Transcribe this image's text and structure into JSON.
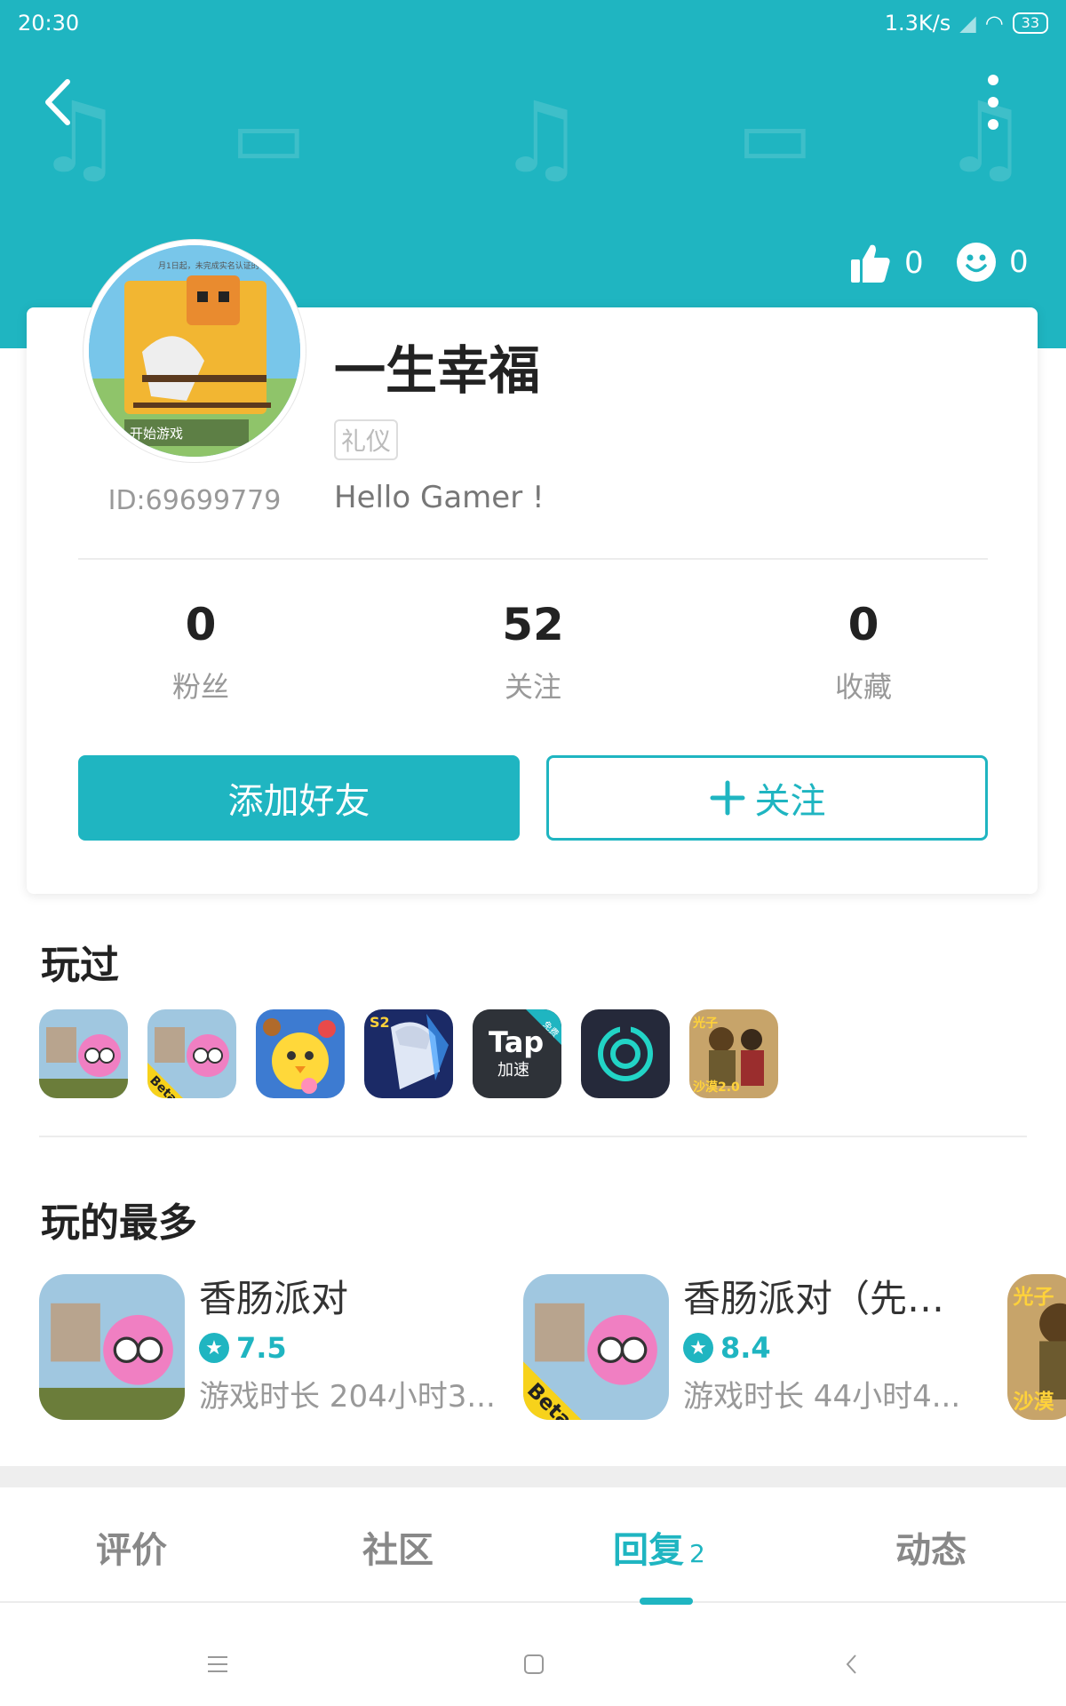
{
  "status_bar": {
    "time": "20:30",
    "network_speed": "1.3K/s",
    "battery": "33"
  },
  "header": {
    "back_icon": "chevron-left-icon",
    "more_icon": "more-vertical-icon",
    "likes": "0",
    "smiles": "0",
    "accent_color": "#1fb5c1"
  },
  "profile": {
    "username": "一生幸福",
    "tag": "礼仪",
    "bio": "Hello Gamer !",
    "user_id": "ID:69699779",
    "avatar_caption": "开始游戏",
    "avatar_notice": "月1日起，未完成实名认证的"
  },
  "counters": [
    {
      "value": "0",
      "label": "粉丝"
    },
    {
      "value": "52",
      "label": "关注"
    },
    {
      "value": "0",
      "label": "收藏"
    }
  ],
  "actions": {
    "add_friend": "添加好友",
    "follow": "关注"
  },
  "played": {
    "title": "玩过",
    "icons": [
      {
        "name": "sausage-party-icon"
      },
      {
        "name": "sausage-party-beta-icon",
        "badge": "Beta"
      },
      {
        "name": "chick-game-icon"
      },
      {
        "name": "anime-game-icon",
        "badge": "S2"
      },
      {
        "name": "tap-accelerator-icon",
        "line1": "Tap",
        "line2": "加速",
        "corner": "免费"
      },
      {
        "name": "circle-app-icon"
      },
      {
        "name": "pubg-icon",
        "badge": "光子",
        "sub": "沙漠2.0"
      }
    ]
  },
  "most_played": {
    "title": "玩的最多",
    "items": [
      {
        "name": "香肠派对",
        "rating": "7.5",
        "time": "游戏时长 204小时3..."
      },
      {
        "name": "香肠派对（先行...",
        "rating": "8.4",
        "time": "游戏时长 44小时4...",
        "badge": "Beta"
      }
    ],
    "partial": {
      "badge": "光子",
      "sub": "沙漠"
    }
  },
  "tabs": [
    {
      "label": "评价"
    },
    {
      "label": "社区"
    },
    {
      "label": "回复",
      "count": "2"
    },
    {
      "label": "动态"
    }
  ]
}
